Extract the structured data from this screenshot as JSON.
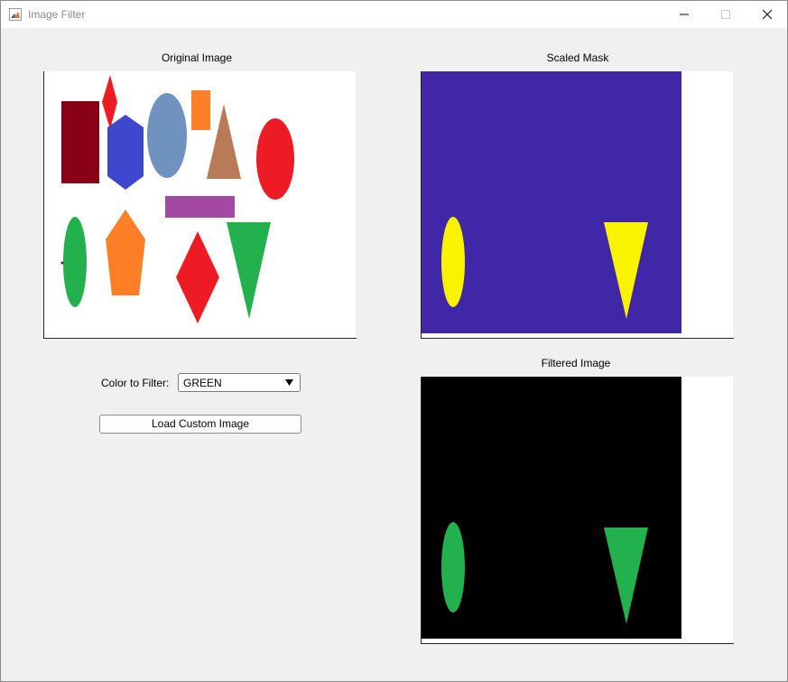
{
  "window": {
    "title": "Image Filter"
  },
  "panels": {
    "original_title": "Original Image",
    "mask_title": "Scaled Mask",
    "filtered_title": "Filtered Image"
  },
  "controls": {
    "filter_label": "Color to Filter:",
    "filter_value": "GREEN",
    "load_button_label": "Load Custom Image"
  },
  "colors": {
    "window_bg": "#f0f0f0",
    "mask_background": "#3f27a8",
    "mask_highlight": "#f9f300",
    "filtered_background": "#000000",
    "filtered_shape": "#22b14c"
  },
  "icons": {
    "app": "matlab-icon",
    "minimize": "minimize-icon",
    "maximize": "maximize-icon",
    "close": "close-icon",
    "dropdown": "triangle-down-icon"
  }
}
